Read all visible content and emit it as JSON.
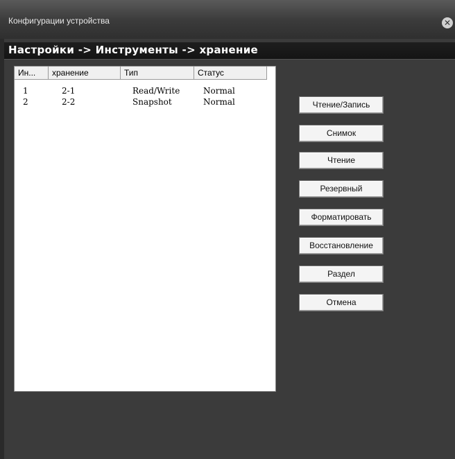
{
  "window": {
    "title": "Конфигурации устройства"
  },
  "breadcrumb": "Настройки -> Инструменты -> хранение",
  "table": {
    "headers": [
      "Ин...",
      "хранение",
      "Тип",
      "Статус"
    ],
    "rows": [
      [
        "1",
        "2-1",
        "Read/Write",
        "Normal"
      ],
      [
        "2",
        "2-2",
        "Snapshot",
        "Normal"
      ]
    ]
  },
  "buttons": {
    "read_write": "Чтение/Запись",
    "snapshot": "Снимок",
    "read": "Чтение",
    "backup": "Резервный",
    "format": "Форматировать",
    "restore": "Восстановление",
    "partition": "Раздел",
    "cancel": "Отмена"
  },
  "icons": {
    "close": "close-icon"
  }
}
